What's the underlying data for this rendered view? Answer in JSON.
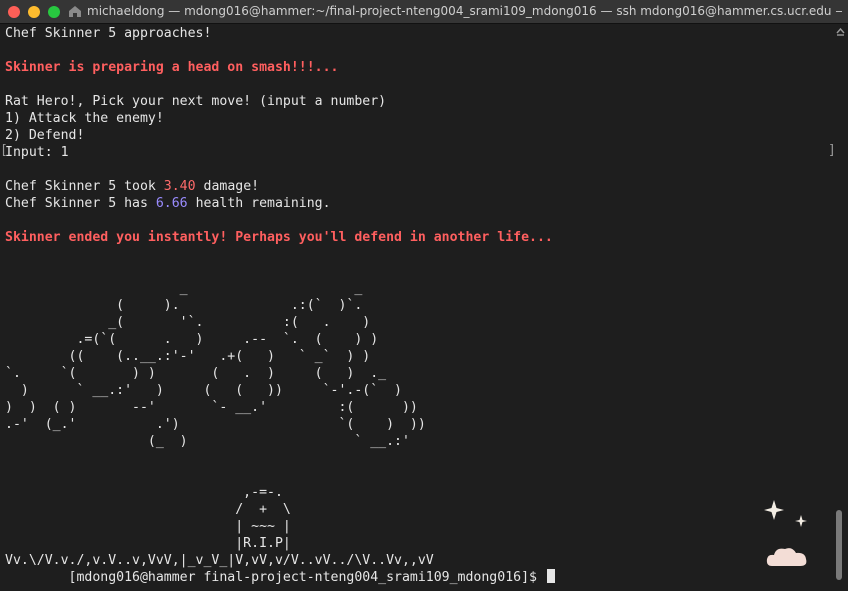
{
  "window": {
    "title": "michaeldong — mdong016@hammer:~/final-project-nteng004_srami109_mdong016 — ssh mdong016@hammer.cs.ucr.edu —..."
  },
  "colors": {
    "red": "#ff5f5f",
    "blue": "#9a8cff",
    "text": "#e6e6e6",
    "bg": "#1e1e1e"
  },
  "terminal": {
    "approach": "Chef Skinner 5 approaches!",
    "preparing": "Skinner is preparing a head on smash!!!...",
    "prompt": "Rat Hero!, Pick your next move! (input a number)",
    "option1": "1) Attack the enemy!",
    "option2": "2) Defend!",
    "input_line": "Input: 1",
    "damage_prefix": "Chef Skinner 5 took ",
    "damage_value": "3.40",
    "damage_suffix": " damage!",
    "health_prefix": "Chef Skinner 5 has ",
    "health_value": "6.66",
    "health_suffix": " health remaining.",
    "ended": "Skinner ended you instantly! Perhaps you'll defend in another life...",
    "art": [
      "                      _                     _",
      "              (     ).              .:(`  )`.",
      "             _(       '`.          :(   .    )",
      "         .=(`(      .   )     .--  `.  (    ) )",
      "        ((    (..__.:'-'   .+(   )   ` _`  ) )",
      "`.     `(       ) )       (   .  )     (   )  ._",
      "  )      ` __.:'   )     (   (   ))     `-'.-(`  )",
      ")  )  ( )       --'       `- __.'         :(      ))",
      ".-'  (_.'          .')                    `(    )  ))",
      "                  (_  )                     ` __.:'",
      "",
      "",
      "                              ,-=-.",
      "                             /  +  \\",
      "                             | ~~~ |",
      "                             |R.I.P|",
      "Vv.\\/V.v./,v.V..v,VvV,|_v_V_|V,vV,v/V..vV../\\V..Vv,,vV"
    ],
    "shell_prompt": "        [mdong016@hammer final-project-nteng004_srami109_mdong016]$ "
  }
}
